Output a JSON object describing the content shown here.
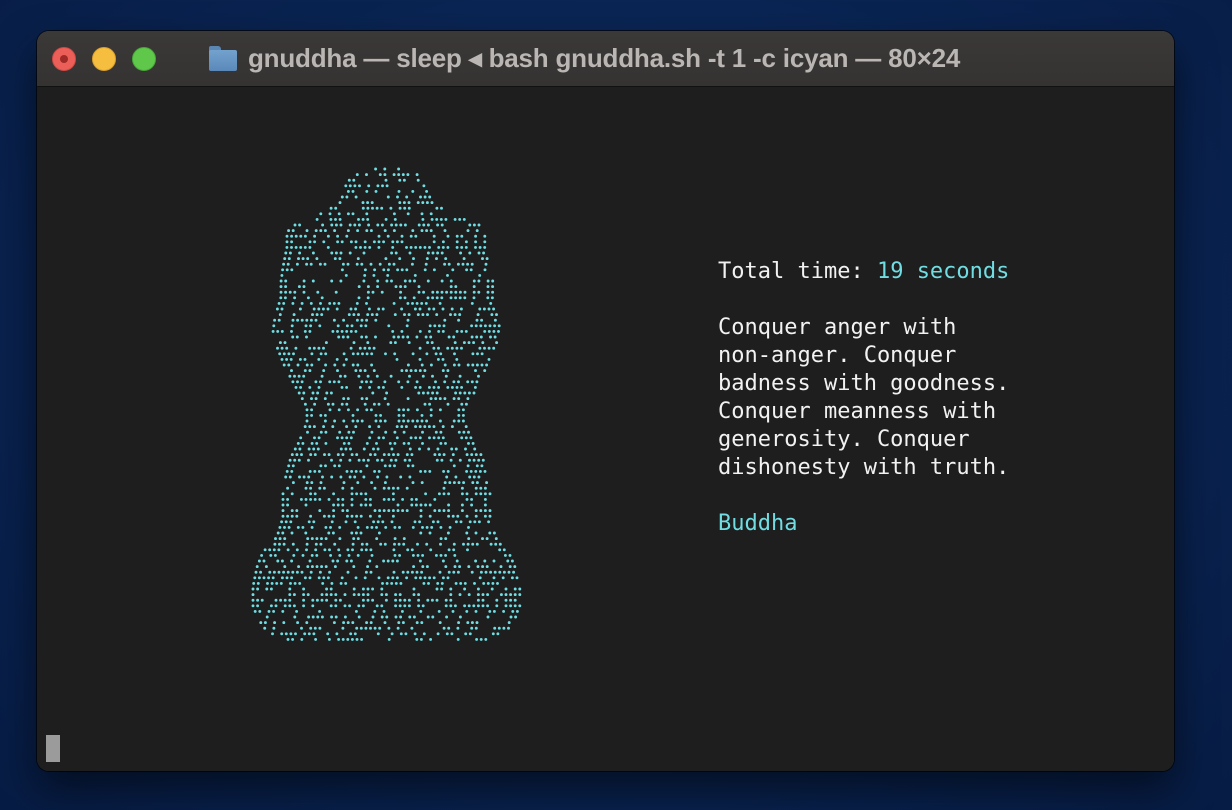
{
  "window": {
    "title": "gnuddha — sleep ◂ bash gnuddha.sh -t 1 -c icyan — 80×24",
    "buttons": [
      "close",
      "minimize",
      "zoom"
    ]
  },
  "terminal": {
    "total_label": "Total time:",
    "total_value": "19 seconds",
    "quote_lines": [
      "Conquer anger with",
      "non-anger. Conquer",
      "badness with goodness.",
      "Conquer meanness with",
      "generosity. Conquer",
      "dishonesty with truth."
    ],
    "author": "Buddha"
  },
  "icons": {
    "folder": "folder-icon",
    "buddha_art": "buddha-braille-art"
  },
  "colors": {
    "background": "#0a2554",
    "terminal_bg": "#1e1e1e",
    "text": "#f2f2f2",
    "accent_cyan": "#6fdde2",
    "close": "#ec5f58",
    "minimize": "#f5be3f",
    "zoom": "#5fc84a"
  }
}
